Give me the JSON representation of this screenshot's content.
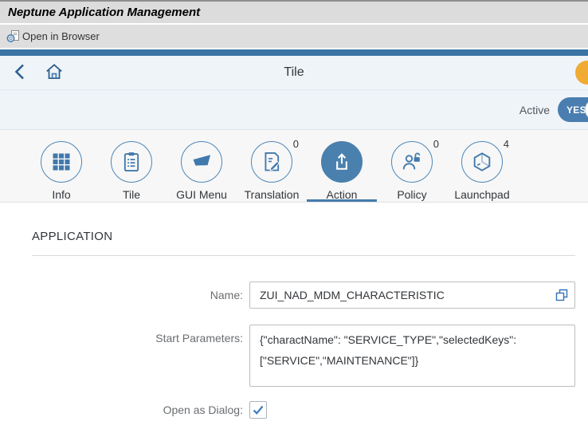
{
  "window": {
    "title": "Neptune Application Management"
  },
  "toolbar": {
    "open_in_browser": "Open in Browser"
  },
  "nav": {
    "title": "Tile"
  },
  "active_row": {
    "label": "Active",
    "toggle_value": "YES",
    "toggle_on": true
  },
  "tabs": {
    "items": [
      {
        "label": "Info",
        "icon": "grid-icon",
        "count": "",
        "selected": false
      },
      {
        "label": "Tile",
        "icon": "clipboard-icon",
        "count": "",
        "selected": false
      },
      {
        "label": "GUI Menu",
        "icon": "gui-menu-icon",
        "count": "",
        "selected": false
      },
      {
        "label": "Translation",
        "icon": "document-edit-icon",
        "count": "0",
        "selected": false
      },
      {
        "label": "Action",
        "icon": "share-icon",
        "count": "",
        "selected": true
      },
      {
        "label": "Policy",
        "icon": "person-unlock-icon",
        "count": "0",
        "selected": false
      },
      {
        "label": "Launchpad",
        "icon": "hexagon-box-icon",
        "count": "4",
        "selected": false
      }
    ]
  },
  "form": {
    "section_title": "APPLICATION",
    "fields": {
      "name": {
        "label": "Name:",
        "value": "ZUI_NAD_MDM_CHARACTERISTIC"
      },
      "start_parameters": {
        "label": "Start Parameters:",
        "value": "{\"charactName\": \"SERVICE_TYPE\",\"selectedKeys\": [\"SERVICE\",\"MAINTENANCE\"]}"
      },
      "open_as_dialog": {
        "label": "Open as Dialog:",
        "checked": true
      }
    }
  },
  "colors": {
    "accent_blue": "#4a80ad",
    "header_bar_blue": "#3a74a4",
    "avatar_orange": "#f0ab32",
    "titlebar_grey": "#dcdcdc"
  }
}
